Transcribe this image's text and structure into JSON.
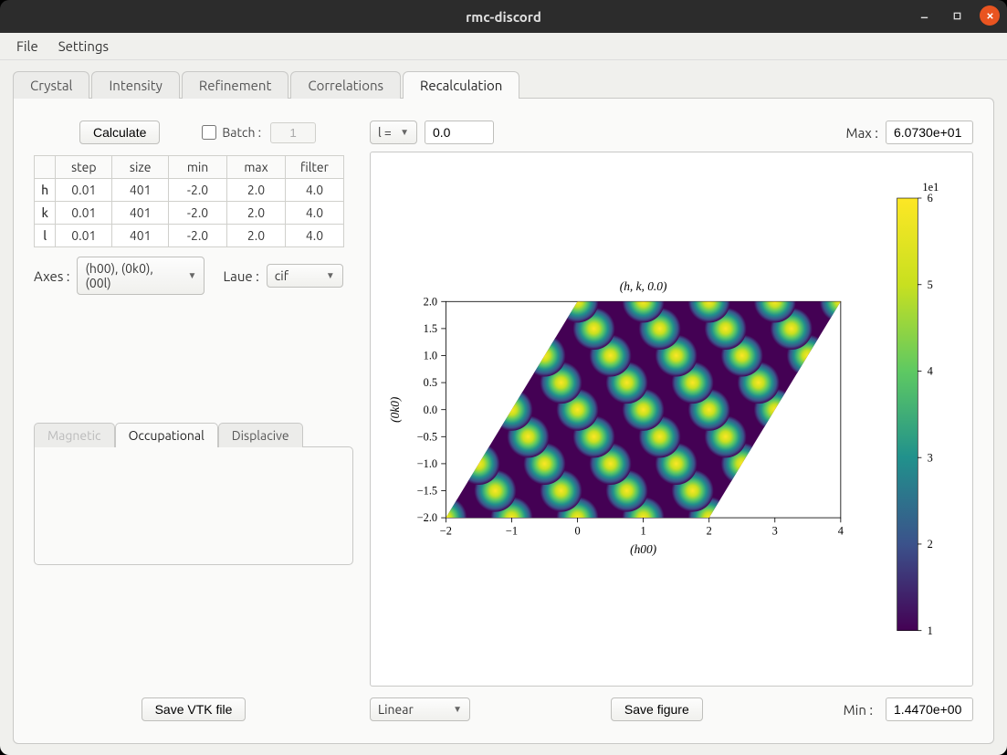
{
  "window_title": "rmc-discord",
  "menubar": {
    "file": "File",
    "settings": "Settings"
  },
  "tabs": {
    "crystal": "Crystal",
    "intensity": "Intensity",
    "refinement": "Refinement",
    "correlations": "Correlations",
    "recalculation": "Recalculation"
  },
  "left": {
    "calculate": "Calculate",
    "batch_label": "Batch :",
    "batch_value": "1",
    "table": {
      "headers": [
        "",
        "step",
        "size",
        "min",
        "max",
        "filter"
      ],
      "rows": [
        {
          "axis": "h",
          "step": "0.01",
          "size": "401",
          "min": "-2.0",
          "max": "2.0",
          "filter": "4.0"
        },
        {
          "axis": "k",
          "step": "0.01",
          "size": "401",
          "min": "-2.0",
          "max": "2.0",
          "filter": "4.0"
        },
        {
          "axis": "l",
          "step": "0.01",
          "size": "401",
          "min": "-2.0",
          "max": "2.0",
          "filter": "4.0"
        }
      ]
    },
    "axes_label": "Axes :",
    "axes_value": "(h00), (0k0), (00l)",
    "laue_label": "Laue :",
    "laue_value": "cif",
    "subtabs": {
      "magnetic": "Magnetic",
      "occupational": "Occupational",
      "displacive": "Displacive"
    },
    "save_vtk": "Save VTK file"
  },
  "right": {
    "slice_axis": "l = ",
    "slice_value": "0.0",
    "max_label": "Max :",
    "max_value": "6.0730e+01",
    "min_label": "Min :",
    "min_value": "1.4470e+00",
    "scale": "Linear",
    "save_figure": "Save figure"
  },
  "chart_data": {
    "type": "heatmap",
    "title": "(h, k, 0.0)",
    "xlabel": "(h00)",
    "ylabel": "(0k0)",
    "xlim": [
      -2,
      4
    ],
    "ylim": [
      -2,
      2
    ],
    "xticks": [
      -2,
      -1,
      0,
      1,
      2,
      3,
      4
    ],
    "yticks": [
      -2.0,
      -1.5,
      -1.0,
      -0.5,
      0.0,
      0.5,
      1.0,
      1.5,
      2.0
    ],
    "colorbar": {
      "scale_label": "1e1",
      "ticks": [
        1,
        2,
        3,
        4,
        5,
        6
      ],
      "min": 0.1447,
      "max": 6.073
    },
    "note": "Parallelogram-shaped heatmap with peaks on a triangular lattice; ~30 bright spots visible. Skew from 60° unit-cell angle.",
    "peak_lattice": {
      "rows": [
        -2,
        -1.5,
        -1,
        -0.5,
        0,
        0.5,
        1,
        1.5,
        2
      ],
      "start_x_at_row0": 0.0,
      "skew_per_row": 0.5,
      "x_spacing": 1.0,
      "count_per_row": 5
    }
  }
}
